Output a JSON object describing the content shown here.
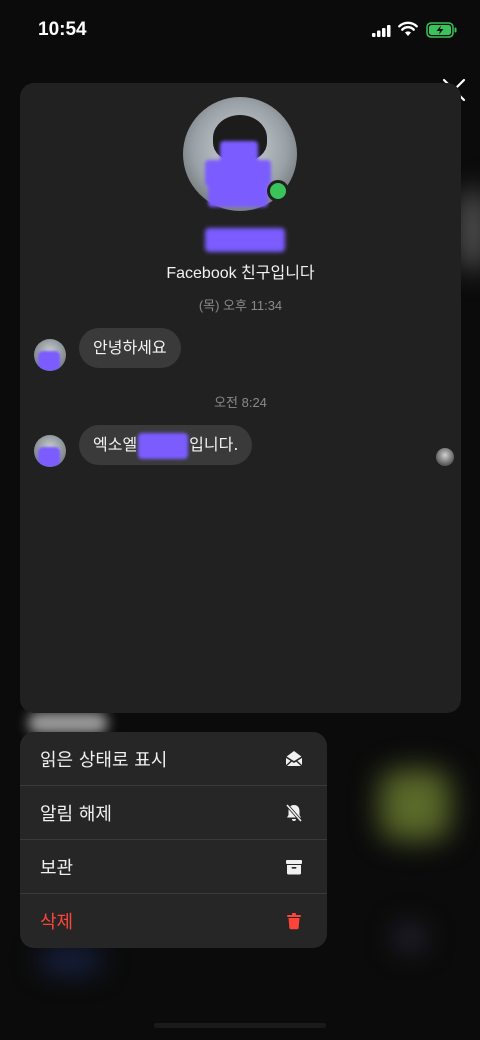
{
  "status_bar": {
    "time": "10:54"
  },
  "preview": {
    "friend_note": "Facebook 친구입니다",
    "messages": [
      {
        "timestamp": "(목) 오후 11:34",
        "text": "안녕하세요"
      },
      {
        "timestamp": "오전 8:24",
        "text_before": "엑소엘",
        "text_after": "입니다."
      }
    ]
  },
  "context_menu": {
    "items": [
      {
        "label": "읽은 상태로 표시",
        "icon": "envelope-open-icon"
      },
      {
        "label": "알림 해제",
        "icon": "bell-slash-icon"
      },
      {
        "label": "보관",
        "icon": "archive-box-icon"
      },
      {
        "label": "삭제",
        "icon": "trash-icon",
        "color": "#ff453a"
      }
    ]
  },
  "colors": {
    "danger": "#ff453a",
    "online": "#3ac35a",
    "redaction": "#7b5cff"
  }
}
